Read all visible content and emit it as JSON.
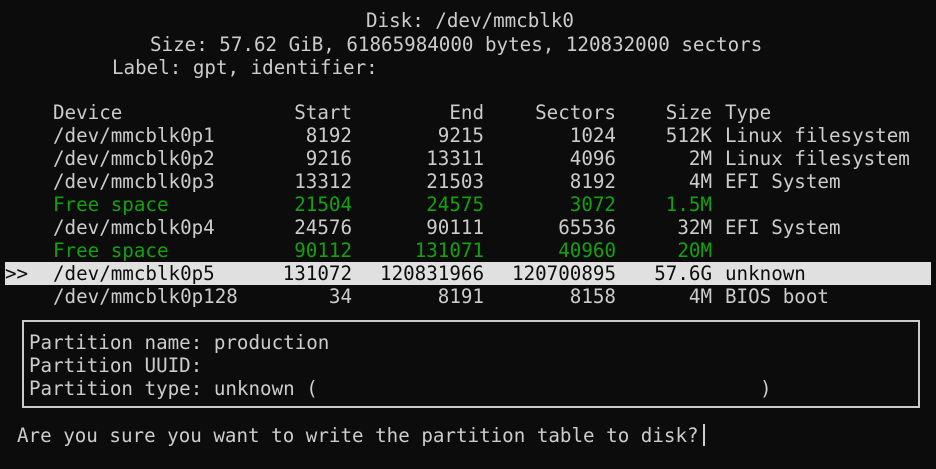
{
  "header": {
    "disk_line": "Disk: /dev/mmcblk0",
    "size_line": "Size: 57.62 GiB, 61865984000 bytes, 120832000 sectors",
    "label_line": "Label: gpt, identifier:"
  },
  "table": {
    "columns": [
      "Device",
      "Start",
      "End",
      "Sectors",
      "Size",
      "Type"
    ],
    "selection_marker": ">>",
    "rows": [
      {
        "device": "/dev/mmcblk0p1",
        "start": "8192",
        "end": "9215",
        "sectors": "1024",
        "size": "512K",
        "type": "Linux filesystem"
      },
      {
        "device": "/dev/mmcblk0p2",
        "start": "9216",
        "end": "13311",
        "sectors": "4096",
        "size": "2M",
        "type": "Linux filesystem"
      },
      {
        "device": "/dev/mmcblk0p3",
        "start": "13312",
        "end": "21503",
        "sectors": "8192",
        "size": "4M",
        "type": "EFI System"
      },
      {
        "device": "Free space",
        "start": "21504",
        "end": "24575",
        "sectors": "3072",
        "size": "1.5M",
        "type": ""
      },
      {
        "device": "/dev/mmcblk0p4",
        "start": "24576",
        "end": "90111",
        "sectors": "65536",
        "size": "32M",
        "type": "EFI System"
      },
      {
        "device": "Free space",
        "start": "90112",
        "end": "131071",
        "sectors": "40960",
        "size": "20M",
        "type": ""
      },
      {
        "device": "/dev/mmcblk0p5",
        "start": "131072",
        "end": "120831966",
        "sectors": "120700895",
        "size": "57.6G",
        "type": "unknown"
      },
      {
        "device": "/dev/mmcblk0p128",
        "start": "34",
        "end": "8191",
        "sectors": "8158",
        "size": "4M",
        "type": "BIOS boot"
      }
    ]
  },
  "info": {
    "name_line": "Partition name: production",
    "uuid_line": "Partition UUID:",
    "type_line": "Partition type: unknown (",
    "type_close": ")"
  },
  "prompt": {
    "text": "Are you sure you want to write the partition table to disk?"
  },
  "colors": {
    "background": "#0c0c0c",
    "foreground": "#cccccc",
    "free_space": "#13a10e",
    "selection": "#e0e0e0"
  }
}
